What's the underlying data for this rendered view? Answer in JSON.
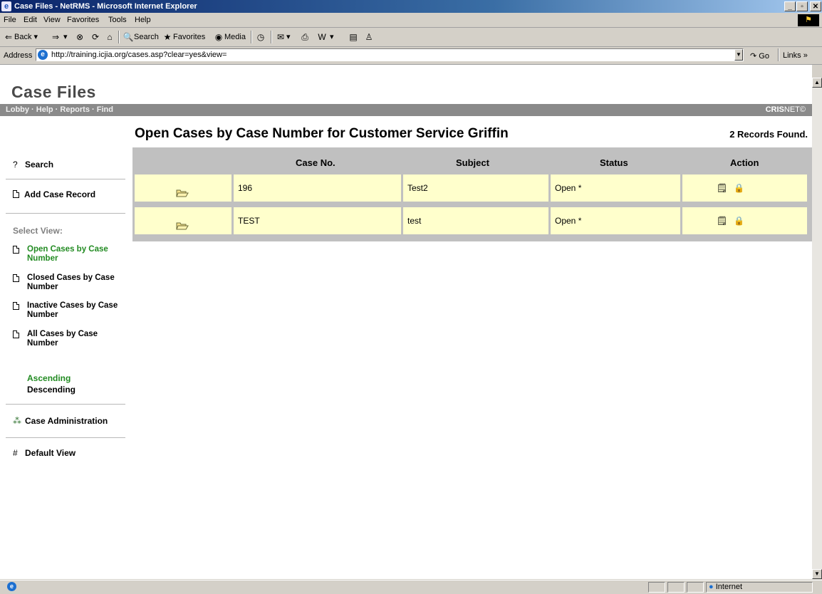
{
  "window": {
    "title": "Case Files - NetRMS - Microsoft Internet Explorer",
    "controls": [
      "_",
      "▫",
      "✕"
    ]
  },
  "menu": [
    "File",
    "Edit",
    "View",
    "Favorites",
    "Tools",
    "Help"
  ],
  "toolbar": {
    "back": "Back",
    "search": "Search",
    "favorites": "Favorites",
    "media": "Media"
  },
  "address": {
    "label": "Address",
    "url": "http://training.icjia.org/cases.asp?clear=yes&view=",
    "go": "Go",
    "links": "Links"
  },
  "page": {
    "title": "Case Files",
    "nav_links": "Lobby · Help · Reports · Find",
    "brand_bold": "CRIS",
    "brand_light": "NET©",
    "heading": "Open Cases by Case Number for Customer Service Griffin",
    "record_count": "2 Records Found."
  },
  "sidebar": {
    "search": "Search",
    "add_case": "Add Case Record",
    "select_view": "Select View:",
    "views": [
      {
        "label": "Open Cases by Case Number",
        "active": true
      },
      {
        "label": "Closed Cases by Case Number",
        "active": false
      },
      {
        "label": "Inactive Cases by Case Number",
        "active": false
      },
      {
        "label": "All Cases by Case Number",
        "active": false
      }
    ],
    "ascending": "Ascending",
    "descending": "Descending",
    "case_admin": "Case Administration",
    "default_view": "Default View"
  },
  "table": {
    "headers": [
      "Case No.",
      "Subject",
      "Status",
      "Action"
    ],
    "rows": [
      {
        "case_no": "196",
        "subject": "Test2",
        "status": "Open *"
      },
      {
        "case_no": "TEST",
        "subject": "test",
        "status": "Open *"
      }
    ]
  },
  "statusbar": {
    "zone": "Internet"
  }
}
